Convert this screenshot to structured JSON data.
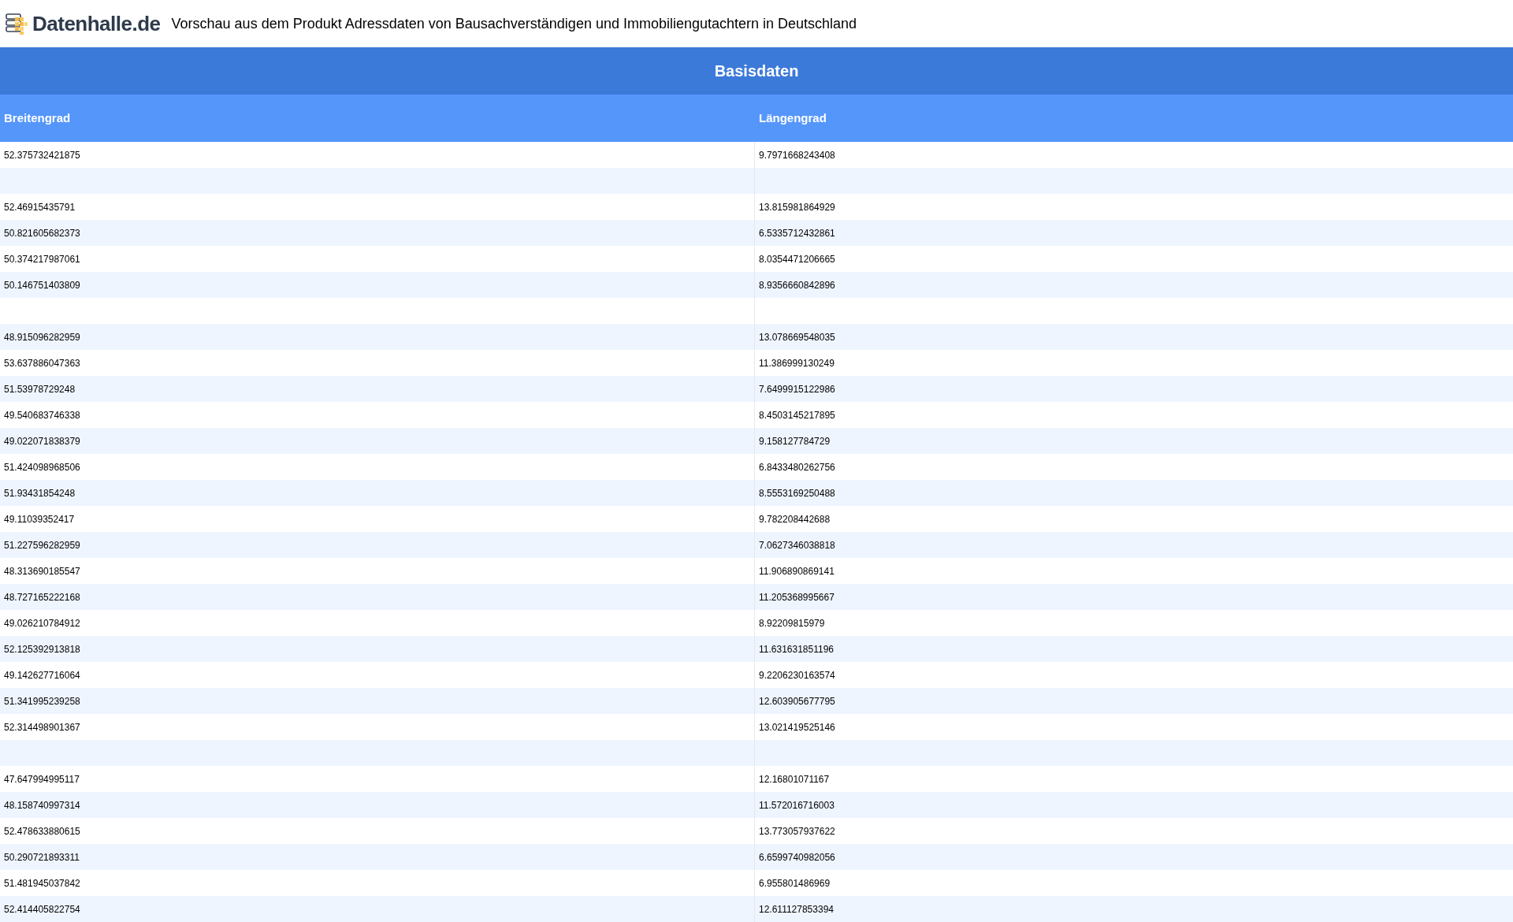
{
  "header": {
    "logo_text": "Datenhalle.de",
    "title": "Vorschau aus dem Produkt Adressdaten von Bausachverständigen und Immobiliengutachtern in Deutschland"
  },
  "table": {
    "title": "Basisdaten",
    "columns": [
      "Breitengrad",
      "Längengrad"
    ],
    "rows": [
      {
        "breitengrad": "52.375732421875",
        "laengengrad": "9.7971668243408"
      },
      {},
      {
        "breitengrad": "52.46915435791",
        "laengengrad": "13.815981864929"
      },
      {
        "breitengrad": "50.821605682373",
        "laengengrad": "6.5335712432861"
      },
      {
        "breitengrad": "50.374217987061",
        "laengengrad": "8.0354471206665"
      },
      {
        "breitengrad": "50.146751403809",
        "laengengrad": "8.9356660842896"
      },
      {},
      {
        "breitengrad": "48.915096282959",
        "laengengrad": "13.078669548035"
      },
      {
        "breitengrad": "53.637886047363",
        "laengengrad": "11.386999130249"
      },
      {
        "breitengrad": "51.53978729248",
        "laengengrad": "7.6499915122986"
      },
      {
        "breitengrad": "49.540683746338",
        "laengengrad": "8.4503145217895"
      },
      {
        "breitengrad": "49.022071838379",
        "laengengrad": "9.158127784729"
      },
      {
        "breitengrad": "51.424098968506",
        "laengengrad": "6.8433480262756"
      },
      {
        "breitengrad": "51.93431854248",
        "laengengrad": "8.5553169250488"
      },
      {
        "breitengrad": "49.11039352417",
        "laengengrad": "9.782208442688"
      },
      {
        "breitengrad": "51.227596282959",
        "laengengrad": "7.0627346038818"
      },
      {
        "breitengrad": "48.313690185547",
        "laengengrad": "11.906890869141"
      },
      {
        "breitengrad": "48.727165222168",
        "laengengrad": "11.205368995667"
      },
      {
        "breitengrad": "49.026210784912",
        "laengengrad": "8.92209815979"
      },
      {
        "breitengrad": "52.125392913818",
        "laengengrad": "11.631631851196"
      },
      {
        "breitengrad": "49.142627716064",
        "laengengrad": "9.2206230163574"
      },
      {
        "breitengrad": "51.341995239258",
        "laengengrad": "12.603905677795"
      },
      {
        "breitengrad": "52.314498901367",
        "laengengrad": "13.021419525146"
      },
      {},
      {
        "breitengrad": "47.647994995117",
        "laengengrad": "12.16801071167"
      },
      {
        "breitengrad": "48.158740997314",
        "laengengrad": "11.572016716003"
      },
      {
        "breitengrad": "52.478633880615",
        "laengengrad": "13.773057937622"
      },
      {
        "breitengrad": "50.290721893311",
        "laengengrad": "6.6599740982056"
      },
      {
        "breitengrad": "51.481945037842",
        "laengengrad": "6.955801486969"
      },
      {
        "breitengrad": "52.414405822754",
        "laengengrad": "12.611127853394"
      }
    ]
  }
}
